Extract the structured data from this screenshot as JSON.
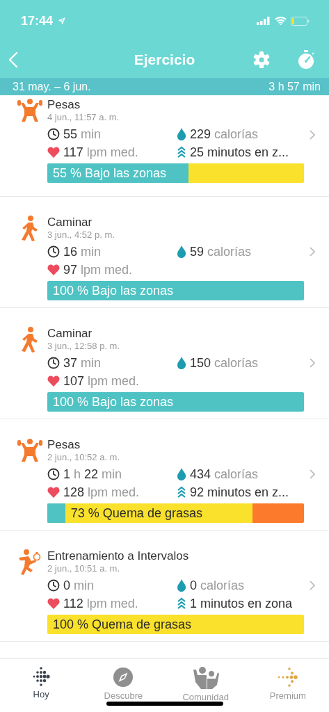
{
  "status_bar": {
    "time": "17:44"
  },
  "nav": {
    "title": "Ejercicio"
  },
  "range": {
    "dates": "31 may. – 6 jun.",
    "total": "3 h 57 min"
  },
  "workouts": [
    {
      "kind": "weights",
      "name": "Pesas",
      "date": "4 jun., 11:57 a. m.",
      "duration": "55 min",
      "calories": "229 calorías",
      "heart_rate": "117 lpm med.",
      "zone_minutes": "25 minutos en z...",
      "bar": {
        "label": "55 % Bajo las zonas",
        "color": "#f9e12c",
        "fills": [
          {
            "color": "#4fc3c4",
            "level": 0.55
          }
        ]
      }
    },
    {
      "kind": "walk",
      "name": "Caminar",
      "date": "3 jun., 4:52 p. m.",
      "duration": "16 min",
      "calories": "59 calorías",
      "heart_rate": "97 lpm med.",
      "bar": {
        "label": "100 % Bajo las zonas",
        "color": "#4fc3c4"
      }
    },
    {
      "kind": "walk",
      "name": "Caminar",
      "date": "3 jun., 12:58 p. m.",
      "duration": "37 min",
      "calories": "150 calorías",
      "heart_rate": "107 lpm med.",
      "bar": {
        "label": "100 % Bajo las zonas",
        "color": "#4fc3c4"
      }
    },
    {
      "kind": "weights",
      "name": "Pesas",
      "date": "2 jun., 10:52 a. m.",
      "duration": "1 h 22 min",
      "calories": "434 calorías",
      "heart_rate": "128 lpm med.",
      "zone_minutes": "92 minutos en z...",
      "bar": {
        "label": "73 % Quema de grasas",
        "color": "#fb7a2c",
        "fills": [
          {
            "color": "#4fc3c4",
            "level": 0.07
          },
          {
            "color": "#f9e12c",
            "level": 0.8
          }
        ]
      }
    },
    {
      "kind": "interval",
      "name": "Entrenamiento a Intervalos",
      "date": "2 jun., 10:51 a. m.",
      "duration": "0 min",
      "calories": "0 calorías",
      "heart_rate": "112 lpm med.",
      "zone_minutes": "1 minutos en zona",
      "bar": {
        "label": "100 % Quema de grasas",
        "color": "#f9e12c"
      }
    }
  ],
  "tabs": [
    {
      "kind": "today",
      "label": "Hoy",
      "selected": true
    },
    {
      "kind": "discover",
      "label": "Descubre",
      "selected": false
    },
    {
      "kind": "community",
      "label": "Comunidad",
      "selected": false
    },
    {
      "kind": "premium",
      "label": "Premium",
      "selected": false
    }
  ]
}
